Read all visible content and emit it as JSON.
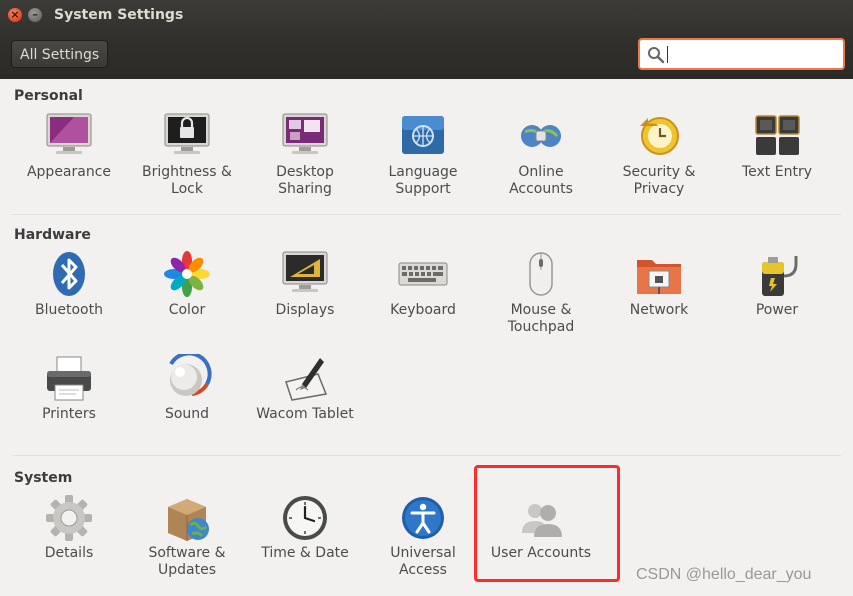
{
  "window": {
    "title": "System Settings",
    "all_settings_label": "All Settings",
    "search_placeholder": ""
  },
  "sections": {
    "personal": {
      "title": "Personal",
      "items": [
        {
          "label": "Appearance",
          "icon": "appearance-icon"
        },
        {
          "label": "Brightness &\nLock",
          "icon": "brightness-lock-icon"
        },
        {
          "label": "Desktop\nSharing",
          "icon": "desktop-sharing-icon"
        },
        {
          "label": "Language\nSupport",
          "icon": "language-support-icon"
        },
        {
          "label": "Online\nAccounts",
          "icon": "online-accounts-icon"
        },
        {
          "label": "Security &\nPrivacy",
          "icon": "security-privacy-icon"
        },
        {
          "label": "Text Entry",
          "icon": "text-entry-icon"
        }
      ]
    },
    "hardware": {
      "title": "Hardware",
      "items": [
        {
          "label": "Bluetooth",
          "icon": "bluetooth-icon"
        },
        {
          "label": "Color",
          "icon": "color-icon"
        },
        {
          "label": "Displays",
          "icon": "displays-icon"
        },
        {
          "label": "Keyboard",
          "icon": "keyboard-icon"
        },
        {
          "label": "Mouse &\nTouchpad",
          "icon": "mouse-touchpad-icon"
        },
        {
          "label": "Network",
          "icon": "network-icon"
        },
        {
          "label": "Power",
          "icon": "power-icon"
        },
        {
          "label": "Printers",
          "icon": "printers-icon"
        },
        {
          "label": "Sound",
          "icon": "sound-icon"
        },
        {
          "label": "Wacom Tablet",
          "icon": "wacom-tablet-icon"
        }
      ]
    },
    "system": {
      "title": "System",
      "items": [
        {
          "label": "Details",
          "icon": "details-icon"
        },
        {
          "label": "Software &\nUpdates",
          "icon": "software-updates-icon"
        },
        {
          "label": "Time & Date",
          "icon": "time-date-icon"
        },
        {
          "label": "Universal\nAccess",
          "icon": "universal-access-icon"
        },
        {
          "label": "User Accounts",
          "icon": "user-accounts-icon"
        }
      ]
    }
  },
  "colors": {
    "highlight_box": "#ff2a2a",
    "search_focus": "#f07746",
    "header_bg": "#3c3b37"
  },
  "watermark": "CSDN @hello_dear_you"
}
